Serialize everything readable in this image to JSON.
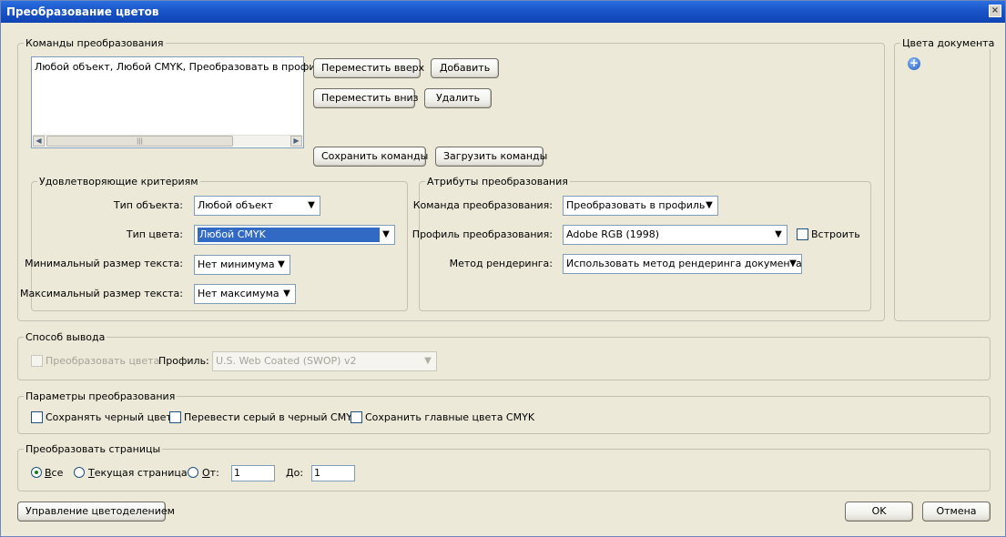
{
  "window": {
    "title": "Преобразование цветов",
    "close": "×"
  },
  "commands": {
    "legend": "Команды преобразования",
    "items": [
      "Любой объект, Любой CMYK, Преобразовать в профиль"
    ],
    "move_up": "Переместить вверх",
    "add": "Добавить",
    "move_down": "Переместить вниз",
    "delete": "Удалить",
    "save": "Сохранить команды",
    "load": "Загрузить команды"
  },
  "criteria": {
    "legend": "Удовлетворяющие критериям",
    "object_type_label": "Тип объекта:",
    "object_type_value": "Любой объект",
    "color_type_label": "Тип цвета:",
    "color_type_value": "Любой CMYK",
    "min_text_label": "Минимальный размер текста:",
    "min_text_value": "Нет минимума",
    "max_text_label": "Максимальный размер текста:",
    "max_text_value": "Нет максимума"
  },
  "attributes": {
    "legend": "Атрибуты преобразования",
    "command_label": "Команда преобразования:",
    "command_value": "Преобразовать в профиль",
    "profile_label": "Профиль преобразования:",
    "profile_value": "Adobe RGB (1998)",
    "embed_label": "Встроить",
    "rendering_label": "Метод рендеринга:",
    "rendering_value": "Использовать метод рендеринга документа"
  },
  "doc_colors": {
    "legend": "Цвета документа"
  },
  "output": {
    "legend": "Способ вывода",
    "convert_label": "Преобразовать цвета",
    "profile_label": "Профиль:",
    "profile_value": "U.S. Web Coated (SWOP) v2"
  },
  "params": {
    "legend": "Параметры преобразования",
    "keep_black": "Сохранять черный цвет",
    "gray_to_black": "Перевести серый в черный CMYK",
    "keep_primary": "Сохранить главные цвета CMYK"
  },
  "pages": {
    "legend": "Преобразовать страницы",
    "all_u": "В",
    "all_rest": "се",
    "current_u": "Т",
    "current_rest": "екущая страница",
    "from_u": "О",
    "from_rest": "т:",
    "from_value": "1",
    "to_u": "Д",
    "to_rest": "о:",
    "to_value": "1"
  },
  "footer": {
    "separation": "Управление цветоделением",
    "ok": "OK",
    "cancel": "Отмена"
  }
}
